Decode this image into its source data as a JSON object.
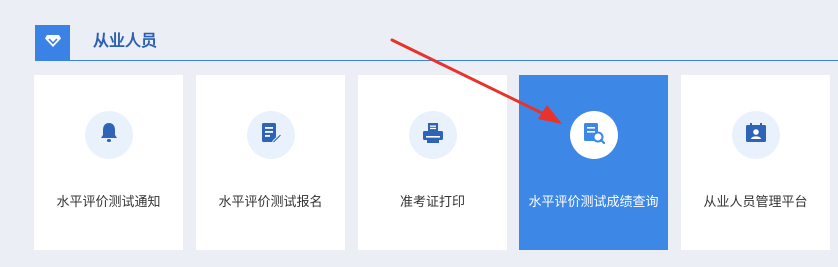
{
  "section": {
    "title": "从业人员",
    "icon": "diamond-icon",
    "accent_color": "#3a82e6"
  },
  "cards": [
    {
      "label": "水平评价测试通知",
      "icon": "bell-icon",
      "active": false
    },
    {
      "label": "水平评价测试报名",
      "icon": "edit-document-icon",
      "active": false
    },
    {
      "label": "准考证打印",
      "icon": "printer-icon",
      "active": false
    },
    {
      "label": "水平评价测试成绩查询",
      "icon": "document-search-icon",
      "active": true
    },
    {
      "label": "从业人员管理平台",
      "icon": "id-card-icon",
      "active": false
    }
  ],
  "annotation": {
    "type": "red-arrow",
    "color": "#e8322b",
    "points_to": "水平评价测试成绩查询"
  }
}
